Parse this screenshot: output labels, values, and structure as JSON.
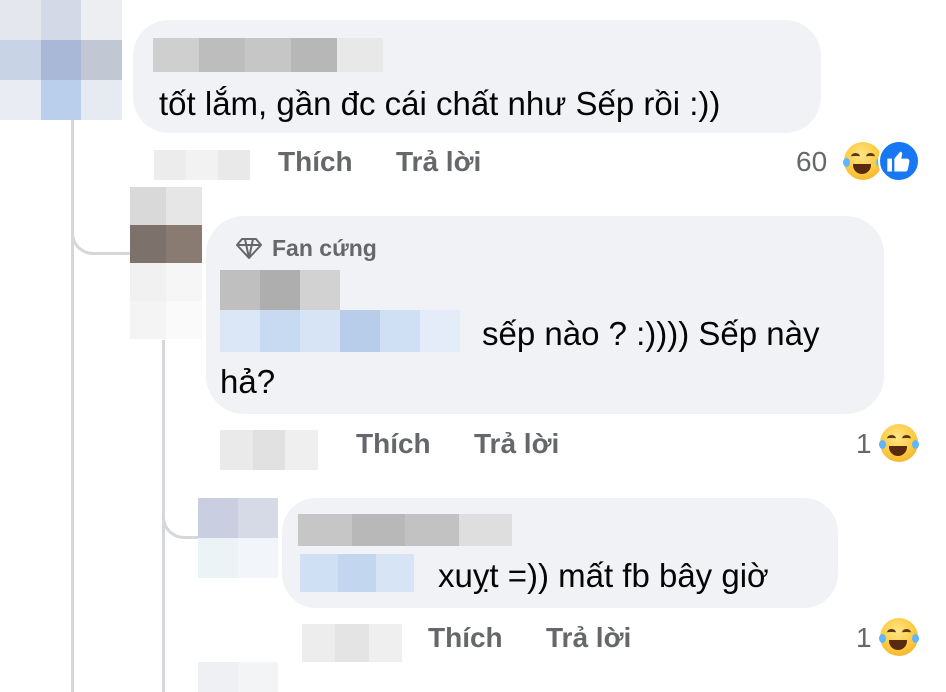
{
  "comments": [
    {
      "text": "tốt lắm, gần đc cái chất như Sếp rồi :))",
      "actions": {
        "like": "Thích",
        "reply": "Trả lời"
      },
      "reaction_count": "60",
      "reactions": [
        "haha-emoji-icon",
        "like-emoji-icon"
      ]
    },
    {
      "badge": "Fan cứng",
      "text_line1": "sếp nào ? :)))) Sếp này",
      "text_line2": "hả?",
      "actions": {
        "like": "Thích",
        "reply": "Trả lời"
      },
      "reaction_count": "1",
      "reactions": [
        "haha-emoji-icon"
      ]
    },
    {
      "text": "xuỵt =)) mất fb bây giờ",
      "actions": {
        "like": "Thích",
        "reply": "Trả lời"
      },
      "reaction_count": "1",
      "reactions": [
        "haha-emoji-icon"
      ]
    }
  ],
  "colors": {
    "bubble": "#f0f2f5",
    "action_text": "#65676b",
    "thread_line": "#d5d7db",
    "like_blue": "#1877f2",
    "haha_yellow": "#fcc93c"
  }
}
